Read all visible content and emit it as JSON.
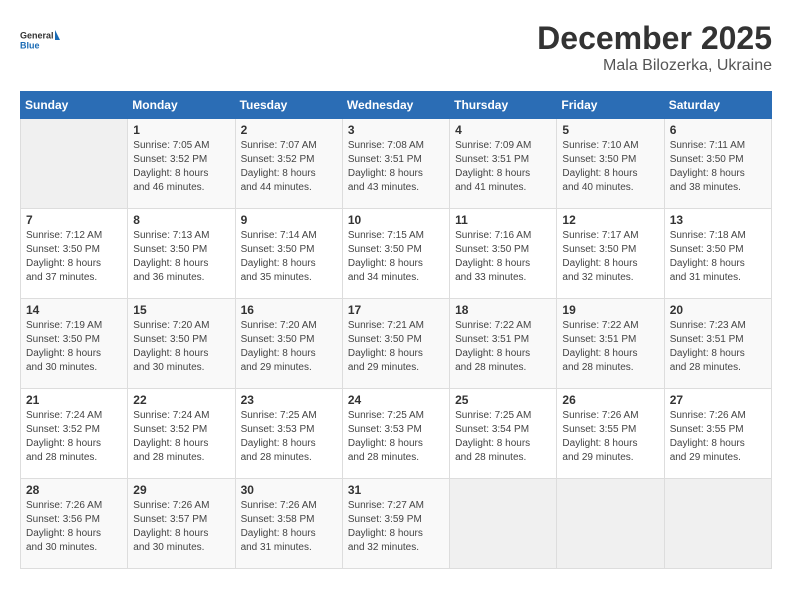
{
  "logo": {
    "text_general": "General",
    "text_blue": "Blue"
  },
  "title": "December 2025",
  "subtitle": "Mala Bilozerka, Ukraine",
  "days_of_week": [
    "Sunday",
    "Monday",
    "Tuesday",
    "Wednesday",
    "Thursday",
    "Friday",
    "Saturday"
  ],
  "weeks": [
    [
      {
        "day": "",
        "empty": true
      },
      {
        "day": "1",
        "sunrise": "7:05 AM",
        "sunset": "3:52 PM",
        "daylight": "8 hours and 46 minutes."
      },
      {
        "day": "2",
        "sunrise": "7:07 AM",
        "sunset": "3:52 PM",
        "daylight": "8 hours and 44 minutes."
      },
      {
        "day": "3",
        "sunrise": "7:08 AM",
        "sunset": "3:51 PM",
        "daylight": "8 hours and 43 minutes."
      },
      {
        "day": "4",
        "sunrise": "7:09 AM",
        "sunset": "3:51 PM",
        "daylight": "8 hours and 41 minutes."
      },
      {
        "day": "5",
        "sunrise": "7:10 AM",
        "sunset": "3:50 PM",
        "daylight": "8 hours and 40 minutes."
      },
      {
        "day": "6",
        "sunrise": "7:11 AM",
        "sunset": "3:50 PM",
        "daylight": "8 hours and 38 minutes."
      }
    ],
    [
      {
        "day": "7",
        "sunrise": "7:12 AM",
        "sunset": "3:50 PM",
        "daylight": "8 hours and 37 minutes."
      },
      {
        "day": "8",
        "sunrise": "7:13 AM",
        "sunset": "3:50 PM",
        "daylight": "8 hours and 36 minutes."
      },
      {
        "day": "9",
        "sunrise": "7:14 AM",
        "sunset": "3:50 PM",
        "daylight": "8 hours and 35 minutes."
      },
      {
        "day": "10",
        "sunrise": "7:15 AM",
        "sunset": "3:50 PM",
        "daylight": "8 hours and 34 minutes."
      },
      {
        "day": "11",
        "sunrise": "7:16 AM",
        "sunset": "3:50 PM",
        "daylight": "8 hours and 33 minutes."
      },
      {
        "day": "12",
        "sunrise": "7:17 AM",
        "sunset": "3:50 PM",
        "daylight": "8 hours and 32 minutes."
      },
      {
        "day": "13",
        "sunrise": "7:18 AM",
        "sunset": "3:50 PM",
        "daylight": "8 hours and 31 minutes."
      }
    ],
    [
      {
        "day": "14",
        "sunrise": "7:19 AM",
        "sunset": "3:50 PM",
        "daylight": "8 hours and 30 minutes."
      },
      {
        "day": "15",
        "sunrise": "7:20 AM",
        "sunset": "3:50 PM",
        "daylight": "8 hours and 30 minutes."
      },
      {
        "day": "16",
        "sunrise": "7:20 AM",
        "sunset": "3:50 PM",
        "daylight": "8 hours and 29 minutes."
      },
      {
        "day": "17",
        "sunrise": "7:21 AM",
        "sunset": "3:50 PM",
        "daylight": "8 hours and 29 minutes."
      },
      {
        "day": "18",
        "sunrise": "7:22 AM",
        "sunset": "3:51 PM",
        "daylight": "8 hours and 28 minutes."
      },
      {
        "day": "19",
        "sunrise": "7:22 AM",
        "sunset": "3:51 PM",
        "daylight": "8 hours and 28 minutes."
      },
      {
        "day": "20",
        "sunrise": "7:23 AM",
        "sunset": "3:51 PM",
        "daylight": "8 hours and 28 minutes."
      }
    ],
    [
      {
        "day": "21",
        "sunrise": "7:24 AM",
        "sunset": "3:52 PM",
        "daylight": "8 hours and 28 minutes."
      },
      {
        "day": "22",
        "sunrise": "7:24 AM",
        "sunset": "3:52 PM",
        "daylight": "8 hours and 28 minutes."
      },
      {
        "day": "23",
        "sunrise": "7:25 AM",
        "sunset": "3:53 PM",
        "daylight": "8 hours and 28 minutes."
      },
      {
        "day": "24",
        "sunrise": "7:25 AM",
        "sunset": "3:53 PM",
        "daylight": "8 hours and 28 minutes."
      },
      {
        "day": "25",
        "sunrise": "7:25 AM",
        "sunset": "3:54 PM",
        "daylight": "8 hours and 28 minutes."
      },
      {
        "day": "26",
        "sunrise": "7:26 AM",
        "sunset": "3:55 PM",
        "daylight": "8 hours and 29 minutes."
      },
      {
        "day": "27",
        "sunrise": "7:26 AM",
        "sunset": "3:55 PM",
        "daylight": "8 hours and 29 minutes."
      }
    ],
    [
      {
        "day": "28",
        "sunrise": "7:26 AM",
        "sunset": "3:56 PM",
        "daylight": "8 hours and 30 minutes."
      },
      {
        "day": "29",
        "sunrise": "7:26 AM",
        "sunset": "3:57 PM",
        "daylight": "8 hours and 30 minutes."
      },
      {
        "day": "30",
        "sunrise": "7:26 AM",
        "sunset": "3:58 PM",
        "daylight": "8 hours and 31 minutes."
      },
      {
        "day": "31",
        "sunrise": "7:27 AM",
        "sunset": "3:59 PM",
        "daylight": "8 hours and 32 minutes."
      },
      {
        "day": "",
        "empty": true
      },
      {
        "day": "",
        "empty": true
      },
      {
        "day": "",
        "empty": true
      }
    ]
  ],
  "labels": {
    "sunrise": "Sunrise:",
    "sunset": "Sunset:",
    "daylight": "Daylight:"
  }
}
